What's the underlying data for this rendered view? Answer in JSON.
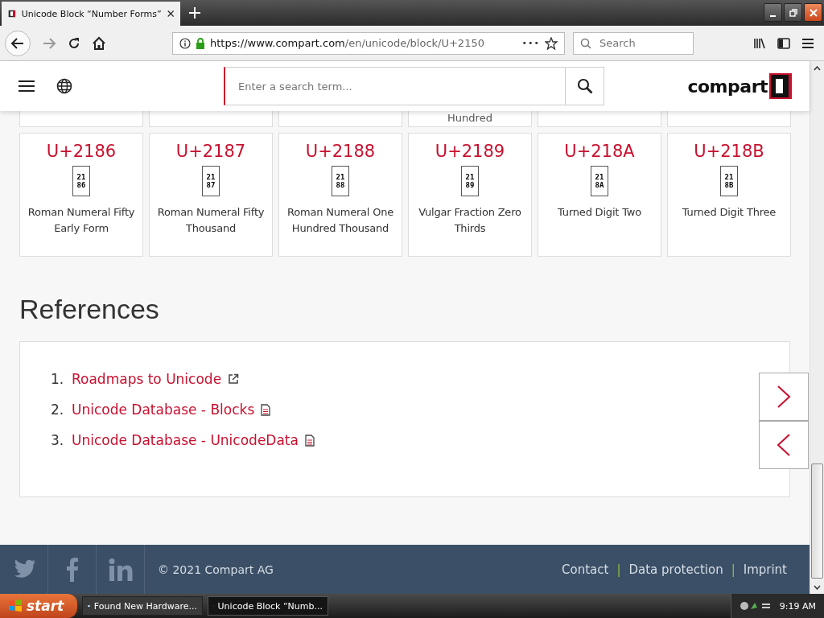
{
  "browser": {
    "tab_title": "Unicode Block “Number Forms”",
    "url_host": "https://www.compart.com",
    "url_path": "/en/unicode/block/U+2150",
    "search_placeholder": "Search",
    "more": "•••"
  },
  "site": {
    "search_placeholder": "Enter a search term...",
    "logo": "compart"
  },
  "partial_cards": [
    {
      "kind": "blank"
    },
    {
      "kind": "blank"
    },
    {
      "kind": "blank"
    },
    {
      "kind": "text",
      "label": "Hundred"
    },
    {
      "kind": "blank"
    },
    {
      "kind": "blank"
    }
  ],
  "cards": [
    {
      "code": "U+2186",
      "glyph": [
        "21",
        "86"
      ],
      "name": "Roman Numeral Fifty Early Form"
    },
    {
      "code": "U+2187",
      "glyph": [
        "21",
        "87"
      ],
      "name": "Roman Numeral Fifty Thousand"
    },
    {
      "code": "U+2188",
      "glyph": [
        "21",
        "88"
      ],
      "name": "Roman Numeral One Hundred Thousand"
    },
    {
      "code": "U+2189",
      "glyph": [
        "21",
        "89"
      ],
      "name": "Vulgar Fraction Zero Thirds"
    },
    {
      "code": "U+218A",
      "glyph": [
        "21",
        "8A"
      ],
      "name": "Turned Digit Two"
    },
    {
      "code": "U+218B",
      "glyph": [
        "21",
        "8B"
      ],
      "name": "Turned Digit Three"
    }
  ],
  "references": {
    "title": "References",
    "items": [
      {
        "number": "1.",
        "label": "Roadmaps to Unicode",
        "kind": "external"
      },
      {
        "number": "2.",
        "label": "Unicode Database - Blocks",
        "kind": "document"
      },
      {
        "number": "3.",
        "label": "Unicode Database - UnicodeData",
        "kind": "document"
      }
    ]
  },
  "footer": {
    "copyright": "© 2021 Compart AG",
    "links": [
      "Contact",
      "Data protection",
      "Imprint"
    ],
    "separator": "|"
  },
  "taskbar": {
    "start": "start",
    "tasks": [
      {
        "label": "Found New Hardware...",
        "selected": false
      },
      {
        "label": "Unicode Block “Numb...",
        "selected": true
      }
    ],
    "time": "9:19 AM"
  }
}
